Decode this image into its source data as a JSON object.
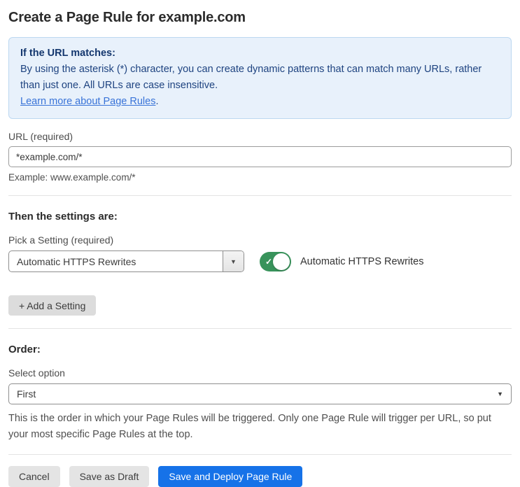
{
  "page": {
    "title": "Create a Page Rule for example.com"
  },
  "info_box": {
    "heading": "If the URL matches:",
    "body": "By using the asterisk (*) character, you can create dynamic patterns that can match many URLs, rather than just one. All URLs are case insensitive.",
    "link": "Learn more about Page Rules",
    "link_suffix": "."
  },
  "url_field": {
    "label": "URL (required)",
    "value": "*example.com/*",
    "helper": "Example: www.example.com/*"
  },
  "settings_section": {
    "heading": "Then the settings are:",
    "picker_label": "Pick a Setting (required)",
    "picker_value": "Automatic HTTPS Rewrites",
    "toggle_state": "on",
    "toggle_label": "Automatic HTTPS Rewrites",
    "add_setting_label": "+ Add a Setting"
  },
  "order_section": {
    "heading": "Order:",
    "select_label": "Select option",
    "select_value": "First",
    "helper": "This is the order in which your Page Rules will be triggered. Only one Page Rule will trigger per URL, so put your most specific Page Rules at the top."
  },
  "footer": {
    "cancel_label": "Cancel",
    "save_draft_label": "Save as Draft",
    "save_deploy_label": "Save and Deploy Page Rule"
  },
  "icons": {
    "caret_down": "▼",
    "check": "✓"
  },
  "colors": {
    "info_bg": "#e8f1fb",
    "info_border": "#bcd8f1",
    "info_heading": "#14376e",
    "info_text": "#1e4380",
    "link_blue": "#3873d8",
    "toggle_green": "#38935b",
    "primary_blue": "#1672e8",
    "button_gray": "#e4e4e4",
    "add_button_gray": "#dcdcdc",
    "divider": "#e4e4e4"
  }
}
